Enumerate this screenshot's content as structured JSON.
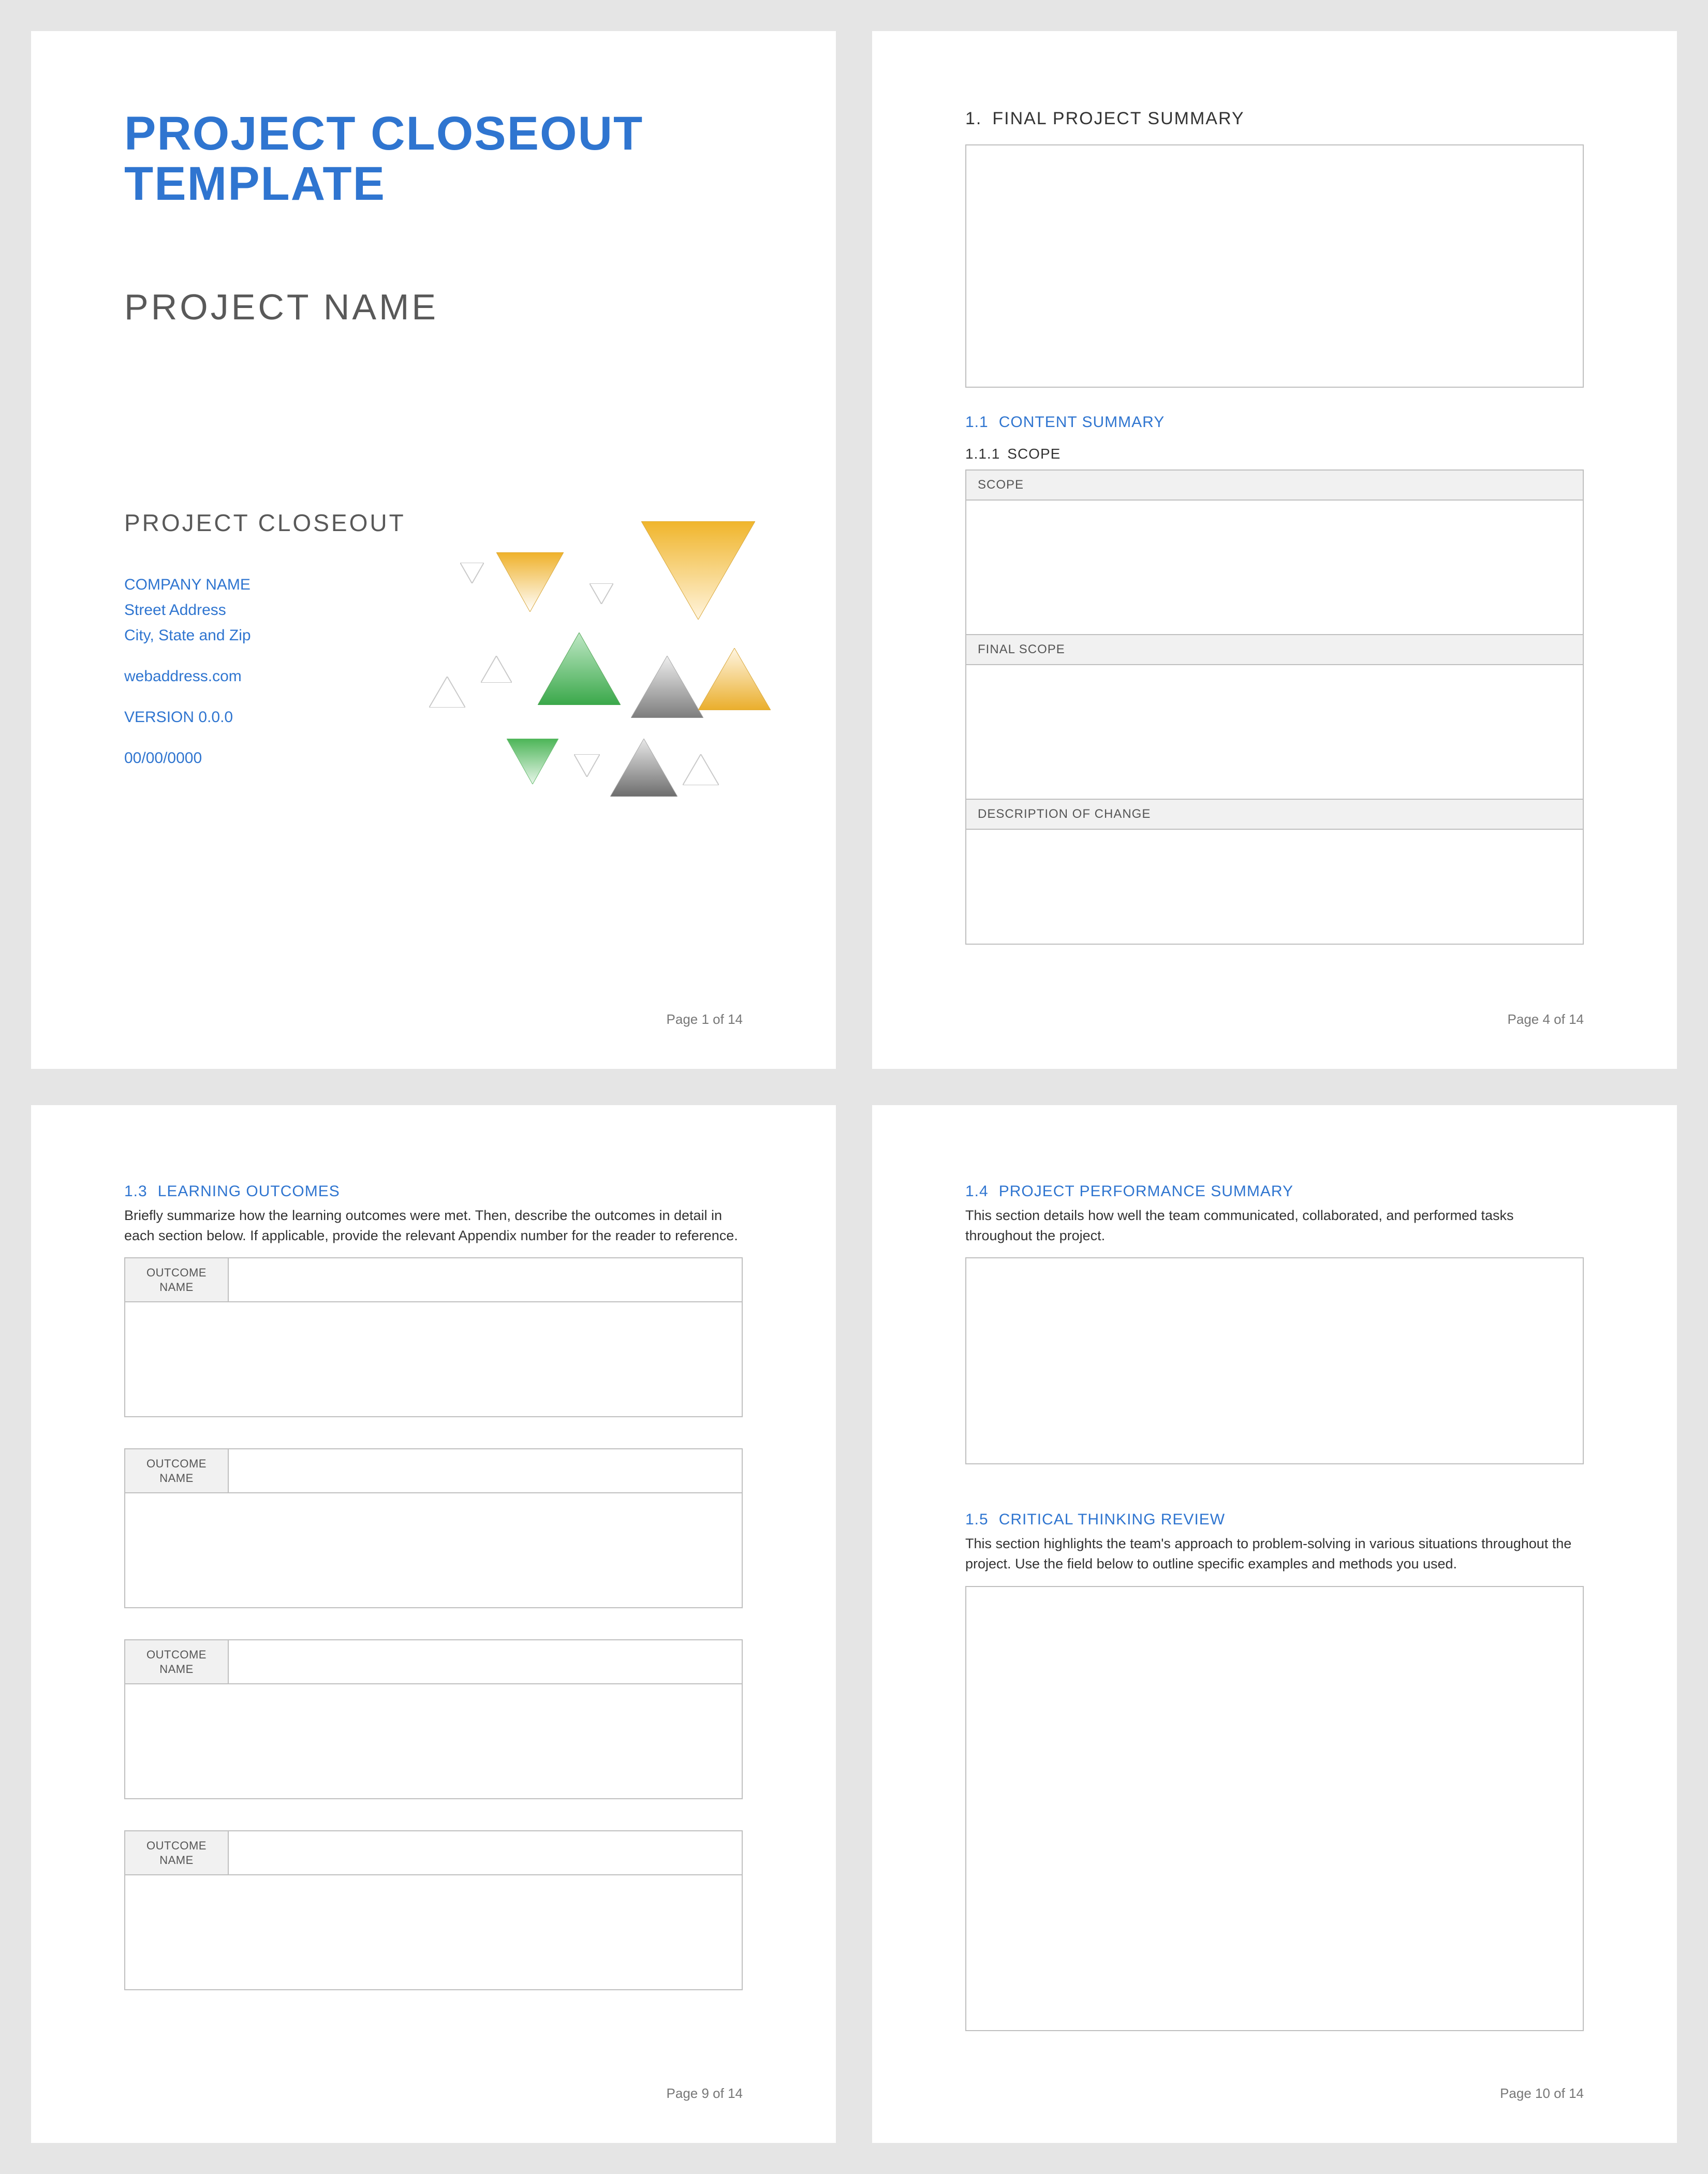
{
  "cover": {
    "title": "PROJECT CLOSEOUT TEMPLATE",
    "projectName": "PROJECT NAME",
    "subtitle": "PROJECT CLOSEOUT",
    "company": "COMPANY NAME",
    "street": "Street Address",
    "cityStateZip": "City, State and Zip",
    "web": "webaddress.com",
    "version": "VERSION 0.0.0",
    "date": "00/00/0000"
  },
  "page2": {
    "h1_num": "1.",
    "h1_text": "FINAL PROJECT SUMMARY",
    "h2_num": "1.1",
    "h2_text": "CONTENT SUMMARY",
    "h3_num": "1.1.1",
    "h3_text": "SCOPE",
    "labels": {
      "scope": "SCOPE",
      "finalScope": "FINAL SCOPE",
      "descChange": "DESCRIPTION OF CHANGE"
    }
  },
  "page3": {
    "h2_num": "1.3",
    "h2_text": "LEARNING OUTCOMES",
    "intro": "Briefly summarize how the learning outcomes were met. Then, describe the outcomes in detail in each section below. If applicable, provide the relevant Appendix number for the reader to reference.",
    "outcomeLabel": "OUTCOME NAME"
  },
  "page4": {
    "s1_num": "1.4",
    "s1_text": "PROJECT PERFORMANCE SUMMARY",
    "s1_intro": "This section details how well the team communicated, collaborated, and performed tasks throughout the project.",
    "s2_num": "1.5",
    "s2_text": "CRITICAL THINKING REVIEW",
    "s2_intro": "This section highlights the team's approach to problem-solving in various situations throughout the project. Use the field below to outline specific examples and methods you used."
  },
  "footer": {
    "p1": "Page 1 of 14",
    "p2": "Page 4 of 14",
    "p3": "Page 9 of 14",
    "p4": "Page 10 of 14"
  }
}
